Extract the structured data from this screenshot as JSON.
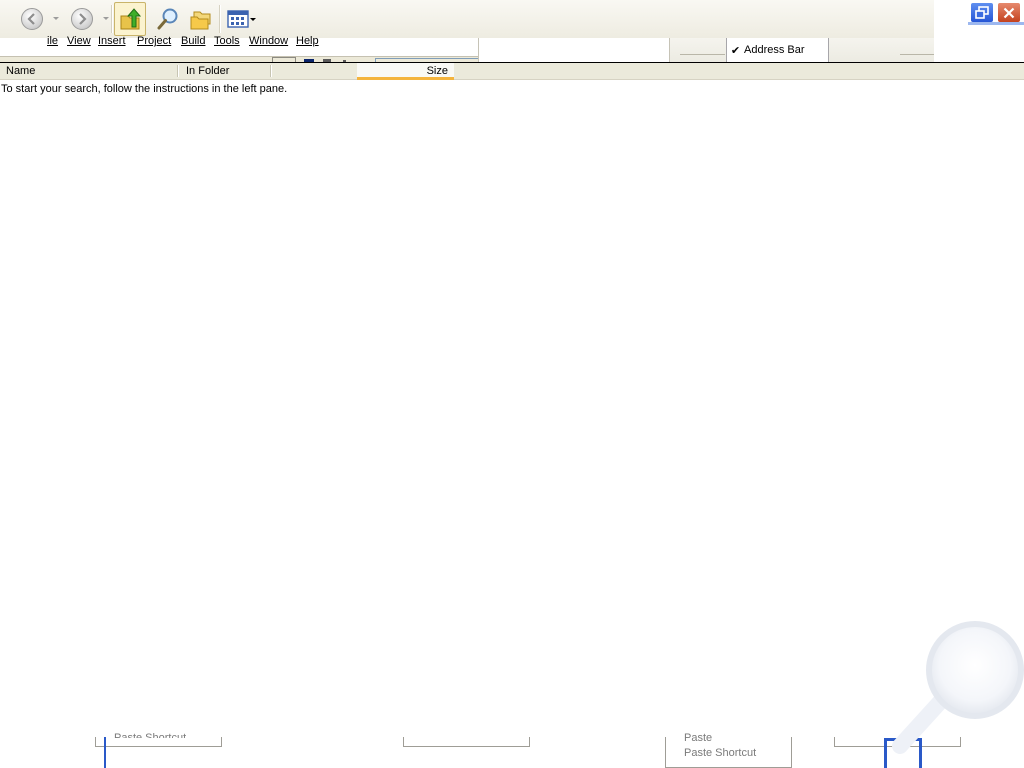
{
  "toolbar": {
    "back_icon": "back-arrow-icon",
    "forward_icon": "forward-arrow-icon",
    "up_icon": "up-folder-icon",
    "search_icon": "search-icon",
    "folders_icon": "folders-icon",
    "views_icon": "views-icon"
  },
  "menubar": {
    "items": [
      "ile",
      "View",
      "Insert",
      "Project",
      "Build",
      "Tools",
      "Window",
      "Help"
    ]
  },
  "context_menu": {
    "checked_item": "Address Bar",
    "check_glyph": "✔"
  },
  "window_buttons": {
    "restore_icon": "restore-icon",
    "close_icon": "close-icon"
  },
  "columns": {
    "name": "Name",
    "in_folder": "In Folder",
    "size": "Size"
  },
  "status": {
    "message": "To start your search, follow the instructions in the left pane."
  },
  "bottom": {
    "paste_shortcut_left": "Paste Shortcut",
    "paste": "Paste",
    "paste_shortcut_right": "Paste Shortcut"
  },
  "colors": {
    "accent": "#f4b43d",
    "header_bg": "#ebeadb",
    "toolbar_bg": "#eeece1",
    "xp_blue": "#2a59c8"
  }
}
